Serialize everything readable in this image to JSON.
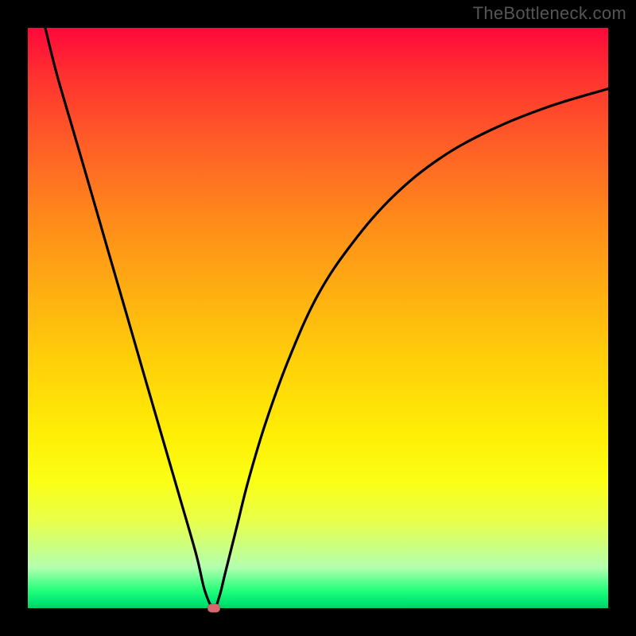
{
  "watermark": "TheBottleneck.com",
  "chart_data": {
    "type": "line",
    "title": "",
    "xlabel": "",
    "ylabel": "",
    "xlim": [
      0,
      100
    ],
    "ylim": [
      0,
      100
    ],
    "series": [
      {
        "name": "bottleneck-curve",
        "x": [
          3,
          5,
          8,
          11,
          14,
          17,
          20,
          23,
          26,
          29,
          30.5,
          32,
          33,
          34,
          36,
          38,
          41,
          45,
          50,
          56,
          63,
          71,
          80,
          90,
          100
        ],
        "y": [
          100,
          92,
          81.7,
          71.4,
          61,
          50.7,
          40.3,
          30,
          19.7,
          9.3,
          3,
          0,
          2,
          6,
          14,
          22,
          32,
          43,
          54,
          63,
          71,
          77.5,
          82.5,
          86.5,
          89.5
        ]
      }
    ],
    "marker": {
      "x": 32,
      "y": 0,
      "label": "optimal-point"
    },
    "colors": {
      "curve": "#000000",
      "marker": "#d26a6f",
      "gradient_top": "#ff083a",
      "gradient_bottom": "#00d060",
      "background_frame": "#000000"
    }
  }
}
